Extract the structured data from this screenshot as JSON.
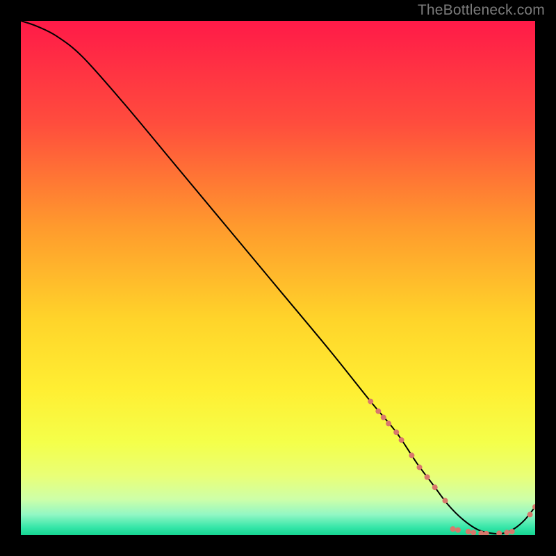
{
  "watermark": "TheBottleneck.com",
  "chart_data": {
    "type": "line",
    "title": "",
    "xlabel": "",
    "ylabel": "",
    "xlim": [
      0,
      100
    ],
    "ylim": [
      0,
      100
    ],
    "grid": false,
    "legend": false,
    "background_gradient": {
      "stops": [
        {
          "offset": 0.0,
          "color": "#ff1a48"
        },
        {
          "offset": 0.2,
          "color": "#ff4d3d"
        },
        {
          "offset": 0.4,
          "color": "#ff9a2d"
        },
        {
          "offset": 0.58,
          "color": "#ffd42a"
        },
        {
          "offset": 0.72,
          "color": "#ffef33"
        },
        {
          "offset": 0.82,
          "color": "#f4ff4a"
        },
        {
          "offset": 0.885,
          "color": "#e9ff77"
        },
        {
          "offset": 0.93,
          "color": "#ceffa8"
        },
        {
          "offset": 0.96,
          "color": "#92f7c4"
        },
        {
          "offset": 0.985,
          "color": "#35e6a8"
        },
        {
          "offset": 1.0,
          "color": "#15d491"
        }
      ]
    },
    "series": [
      {
        "name": "curve",
        "color": "#000000",
        "x": [
          0,
          3,
          7,
          12,
          20,
          30,
          40,
          50,
          60,
          68,
          73,
          77,
          80,
          83,
          86,
          89,
          92,
          94,
          96,
          98,
          100
        ],
        "y": [
          100,
          99,
          97,
          93,
          84,
          72,
          60,
          48,
          36,
          26,
          20,
          14,
          10,
          6,
          3,
          1,
          0.3,
          0.4,
          1.3,
          3.0,
          5.5
        ]
      }
    ],
    "bead_points": {
      "color": "#d8786c",
      "radius": 4,
      "points": [
        {
          "x": 68.0,
          "y": 26.0
        },
        {
          "x": 69.5,
          "y": 24.1
        },
        {
          "x": 70.5,
          "y": 22.9
        },
        {
          "x": 71.5,
          "y": 21.7
        },
        {
          "x": 73.0,
          "y": 20.0
        },
        {
          "x": 74.0,
          "y": 18.5
        },
        {
          "x": 76.0,
          "y": 15.5
        },
        {
          "x": 77.5,
          "y": 13.2
        },
        {
          "x": 79.0,
          "y": 11.3
        },
        {
          "x": 80.5,
          "y": 9.3
        },
        {
          "x": 82.5,
          "y": 6.7
        },
        {
          "x": 84.0,
          "y": 1.2
        },
        {
          "x": 85.0,
          "y": 1.0
        },
        {
          "x": 87.0,
          "y": 0.7
        },
        {
          "x": 88.0,
          "y": 0.5
        },
        {
          "x": 89.5,
          "y": 0.35
        },
        {
          "x": 90.5,
          "y": 0.3
        },
        {
          "x": 93.0,
          "y": 0.35
        },
        {
          "x": 94.5,
          "y": 0.5
        },
        {
          "x": 95.5,
          "y": 0.7
        },
        {
          "x": 99.0,
          "y": 4.0
        },
        {
          "x": 100.0,
          "y": 5.5
        }
      ]
    }
  }
}
